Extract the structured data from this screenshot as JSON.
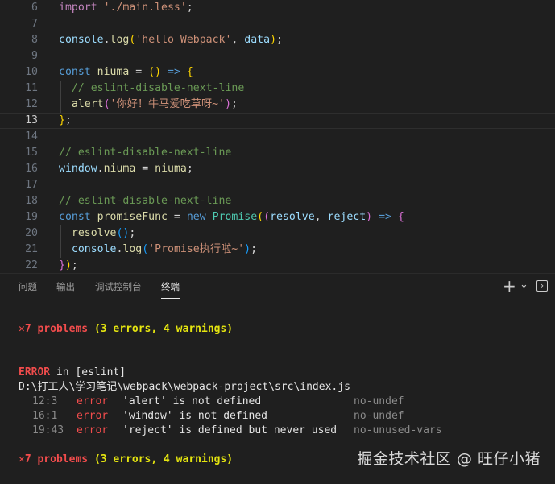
{
  "editor": {
    "lines": [
      {
        "n": "6",
        "parts": [
          [
            "imp",
            "import "
          ],
          [
            "str",
            "'./main.less'"
          ],
          [
            "pl",
            ";"
          ]
        ]
      },
      {
        "n": "7",
        "parts": []
      },
      {
        "n": "8",
        "parts": [
          [
            "var",
            "console"
          ],
          [
            "pl",
            "."
          ],
          [
            "fn",
            "log"
          ],
          [
            "br1",
            "("
          ],
          [
            "str",
            "'hello Webpack'"
          ],
          [
            "pl",
            ", "
          ],
          [
            "var",
            "data"
          ],
          [
            "br1",
            ")"
          ],
          [
            "pl",
            ";"
          ]
        ]
      },
      {
        "n": "9",
        "parts": []
      },
      {
        "n": "10",
        "parts": [
          [
            "kw",
            "const "
          ],
          [
            "fn",
            "niuma"
          ],
          [
            "pl",
            " = "
          ],
          [
            "br1",
            "()"
          ],
          [
            "pl",
            " "
          ],
          [
            "op",
            "=>"
          ],
          [
            "pl",
            " "
          ],
          [
            "br1",
            "{"
          ]
        ]
      },
      {
        "n": "11",
        "parts": [
          [
            "pl",
            "  "
          ],
          [
            "cm",
            "// eslint-disable-next-line"
          ]
        ]
      },
      {
        "n": "12",
        "parts": [
          [
            "pl",
            "  "
          ],
          [
            "fn",
            "alert"
          ],
          [
            "br2",
            "("
          ],
          [
            "str",
            "'你好！牛马爱吃草呀~'"
          ],
          [
            "br2",
            ")"
          ],
          [
            "pl",
            ";"
          ]
        ]
      },
      {
        "n": "13",
        "parts": [
          [
            "br1",
            "}"
          ],
          [
            "pl",
            ";"
          ]
        ],
        "current": true
      },
      {
        "n": "14",
        "parts": []
      },
      {
        "n": "15",
        "parts": [
          [
            "cm",
            "// eslint-disable-next-line"
          ]
        ]
      },
      {
        "n": "16",
        "parts": [
          [
            "var",
            "window"
          ],
          [
            "pl",
            "."
          ],
          [
            "fn",
            "niuma"
          ],
          [
            "pl",
            " = "
          ],
          [
            "fn",
            "niuma"
          ],
          [
            "pl",
            ";"
          ]
        ]
      },
      {
        "n": "17",
        "parts": []
      },
      {
        "n": "18",
        "parts": [
          [
            "cm",
            "// eslint-disable-next-line"
          ]
        ]
      },
      {
        "n": "19",
        "parts": [
          [
            "kw",
            "const "
          ],
          [
            "fn",
            "promiseFunc"
          ],
          [
            "pl",
            " = "
          ],
          [
            "kw",
            "new "
          ],
          [
            "cls",
            "Promise"
          ],
          [
            "br1",
            "("
          ],
          [
            "br2",
            "("
          ],
          [
            "var",
            "resolve"
          ],
          [
            "pl",
            ", "
          ],
          [
            "var",
            "reject"
          ],
          [
            "br2",
            ")"
          ],
          [
            "pl",
            " "
          ],
          [
            "op",
            "=>"
          ],
          [
            "pl",
            " "
          ],
          [
            "br2",
            "{"
          ]
        ]
      },
      {
        "n": "20",
        "parts": [
          [
            "pl",
            "  "
          ],
          [
            "fn",
            "resolve"
          ],
          [
            "br3",
            "()"
          ],
          [
            "pl",
            ";"
          ]
        ]
      },
      {
        "n": "21",
        "parts": [
          [
            "pl",
            "  "
          ],
          [
            "var",
            "console"
          ],
          [
            "pl",
            "."
          ],
          [
            "fn",
            "log"
          ],
          [
            "br3",
            "("
          ],
          [
            "str",
            "'Promise执行啦~'"
          ],
          [
            "br3",
            ")"
          ],
          [
            "pl",
            ";"
          ]
        ]
      },
      {
        "n": "22",
        "parts": [
          [
            "br2",
            "}"
          ],
          [
            "br1",
            ")"
          ],
          [
            "pl",
            ";"
          ]
        ]
      }
    ]
  },
  "panel": {
    "tabs": [
      "问题",
      "输出",
      "调试控制台",
      "终端"
    ],
    "active_tab": "终端",
    "add_icon": "+",
    "dropdown_icon": "⌄",
    "terminal_icon": "›"
  },
  "terminal": {
    "summary_mark": "✕",
    "summary_count": "7 problems",
    "summary_errors": "(3 errors, ",
    "summary_warnings": "4 warnings)",
    "error_label": "ERROR",
    "error_in": " in [eslint]",
    "path": "D:\\打工人\\学习笔记\\webpack\\webpack-project\\src\\index.js",
    "problems": [
      {
        "pos": "12:3",
        "level": "error",
        "msg": "'alert' is not defined",
        "rule": "no-undef"
      },
      {
        "pos": "16:1",
        "level": "error",
        "msg": "'window' is not defined",
        "rule": "no-undef"
      },
      {
        "pos": "19:43",
        "level": "error",
        "msg": "'reject' is defined but never used",
        "rule": "no-unused-vars"
      }
    ]
  },
  "watermark": "掘金技术社区 @ 旺仔小猪"
}
